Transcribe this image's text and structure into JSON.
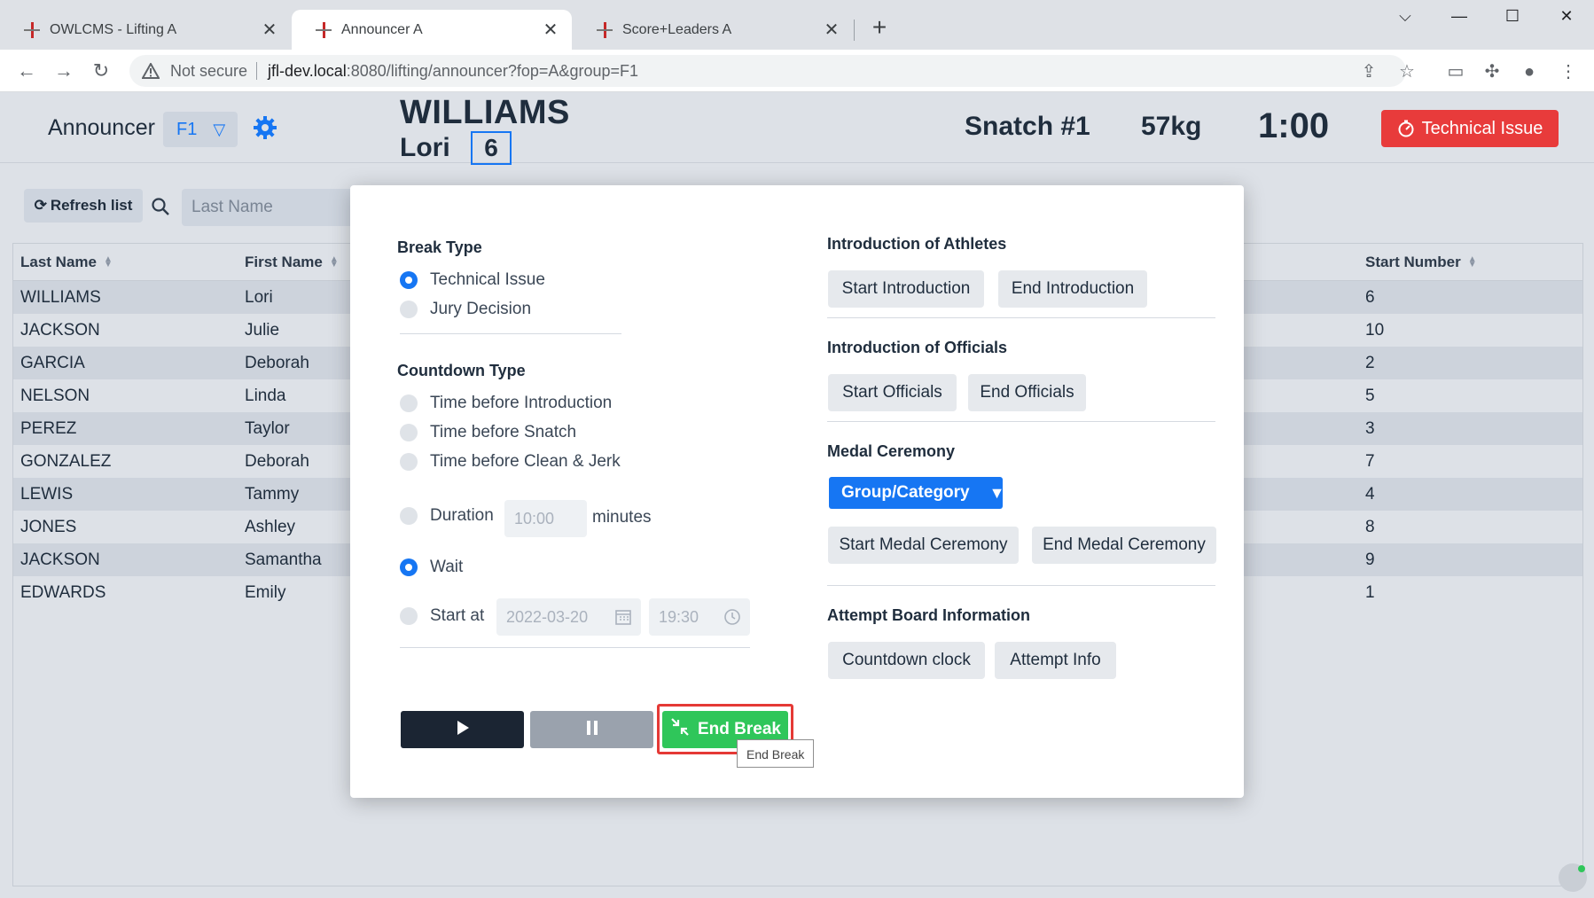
{
  "browser": {
    "tabs": [
      {
        "title": "OWLCMS - Lifting A",
        "close": "✕"
      },
      {
        "title": "Announcer A",
        "close": "✕"
      },
      {
        "title": "Score+Leaders A",
        "close": "✕"
      }
    ],
    "new_tab": "+",
    "window_controls": {
      "dropdown": "⌵",
      "minimize": "—",
      "maximize": "☐",
      "close": "✕"
    },
    "not_secure": "Not secure",
    "url_host": "jfl-dev.local",
    "url_rest": ":8080/lifting/announcer?fop=A&group=F1"
  },
  "header": {
    "title": "Announcer",
    "group": "F1",
    "athlete_last": "WILLIAMS",
    "athlete_first": "Lori",
    "start_number": "6",
    "attempt": "Snatch #1",
    "weight": "57kg",
    "clock": "1:00",
    "tech_button": "Technical Issue"
  },
  "list": {
    "refresh_label": "Refresh list",
    "search_placeholder": "Last Name",
    "columns": [
      "Last Name",
      "First Name",
      "Start Number"
    ],
    "rows": [
      {
        "last": "WILLIAMS",
        "first": "Lori",
        "start": "6"
      },
      {
        "last": "JACKSON",
        "first": "Julie",
        "start": "10"
      },
      {
        "last": "GARCIA",
        "first": "Deborah",
        "start": "2"
      },
      {
        "last": "NELSON",
        "first": "Linda",
        "start": "5"
      },
      {
        "last": "PEREZ",
        "first": "Taylor",
        "start": "3"
      },
      {
        "last": "GONZALEZ",
        "first": "Deborah",
        "start": "7"
      },
      {
        "last": "LEWIS",
        "first": "Tammy",
        "start": "4"
      },
      {
        "last": "JONES",
        "first": "Ashley",
        "start": "8"
      },
      {
        "last": "JACKSON",
        "first": "Samantha",
        "start": "9"
      },
      {
        "last": "EDWARDS",
        "first": "Emily",
        "start": "1"
      }
    ]
  },
  "dialog": {
    "break_type_title": "Break Type",
    "break_types": [
      "Technical Issue",
      "Jury Decision"
    ],
    "countdown_title": "Countdown Type",
    "countdown_types": [
      "Time before Introduction",
      "Time before Snatch",
      "Time before Clean & Jerk"
    ],
    "duration_label": "Duration",
    "duration_value": "10:00",
    "minutes_label": "minutes",
    "wait_label": "Wait",
    "start_at_label": "Start at",
    "start_date": "2022-03-20",
    "start_time": "19:30",
    "end_break_label": "End Break",
    "tooltip": "End Break",
    "intro_athletes_title": "Introduction of Athletes",
    "start_intro": "Start Introduction",
    "end_intro": "End Introduction",
    "intro_officials_title": "Introduction of Officials",
    "start_officials": "Start Officials",
    "end_officials": "End Officials",
    "medal_title": "Medal Ceremony",
    "medal_dropdown": "Group/Category",
    "start_medal": "Start Medal Ceremony",
    "end_medal": "End Medal Ceremony",
    "attempt_board_title": "Attempt Board Information",
    "countdown_clock": "Countdown clock",
    "attempt_info": "Attempt Info"
  },
  "colors": {
    "accent": "#1676f3",
    "danger": "#e83b3b",
    "success": "#2fc65a",
    "dark": "#1b2533"
  }
}
